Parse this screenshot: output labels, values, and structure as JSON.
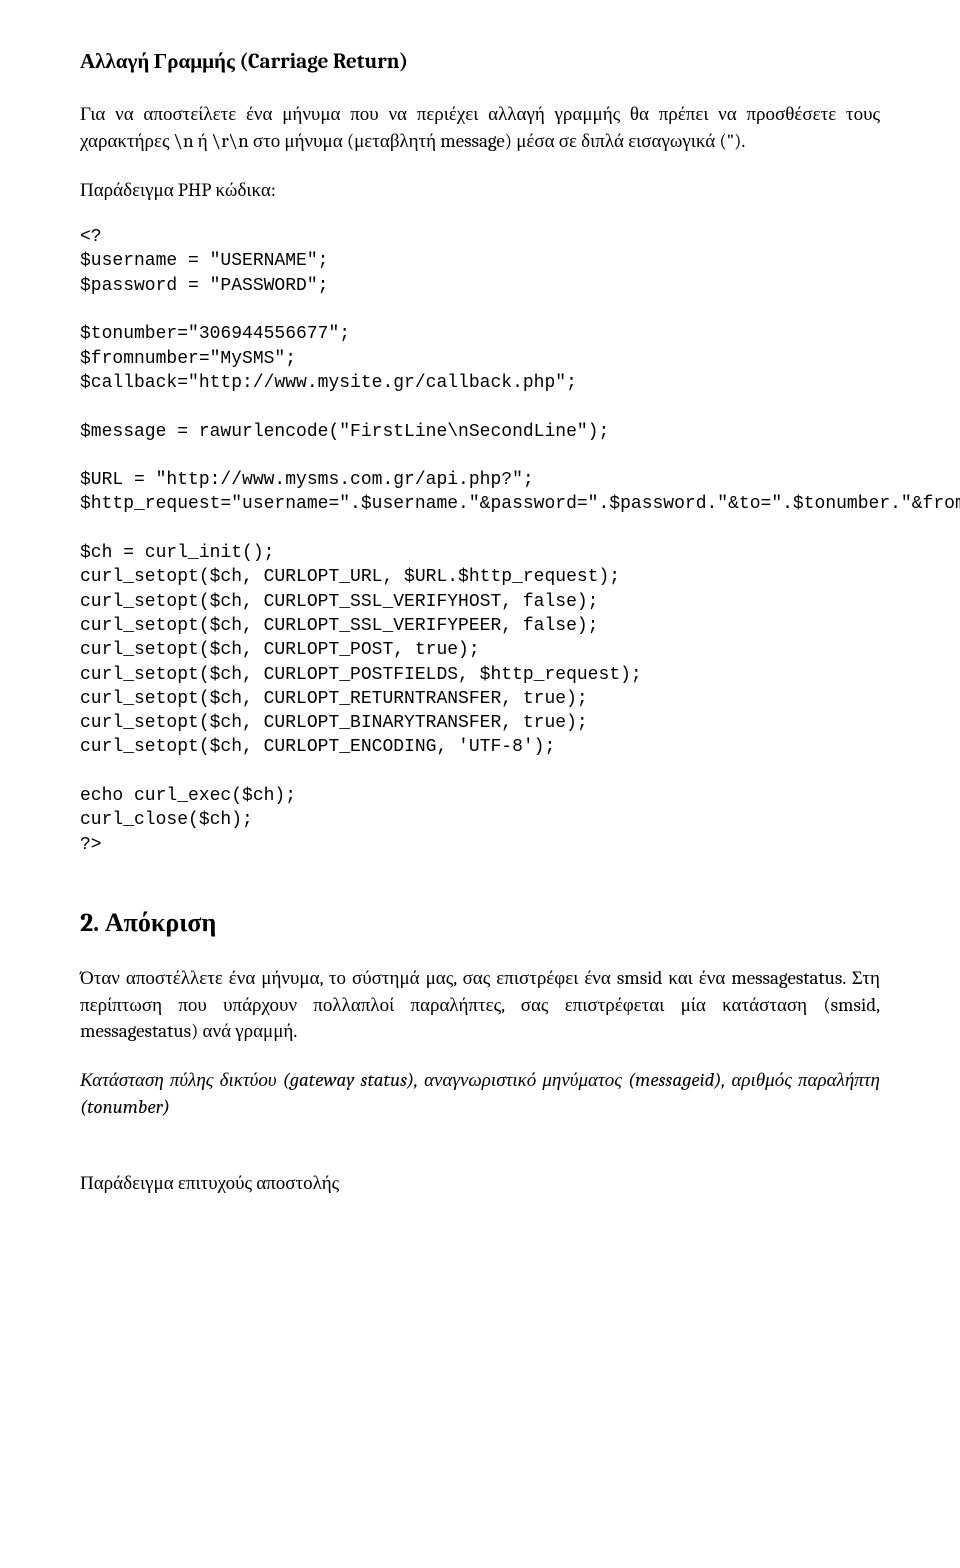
{
  "heading1": "Αλλαγή Γραμμής (Carriage Return)",
  "para1": "Για να αποστείλετε ένα μήνυμα που να περιέχει αλλαγή γραμμής θα πρέπει να προσθέσετε τους χαρακτήρες \\n ή \\r\\n στο μήνυμα (μεταβλητή message) μέσα σε διπλά εισαγωγικά (\").",
  "para2": "Παράδειγμα PHP κώδικα:",
  "code": "<?\n$username = \"USERNAME\";\n$password = \"PASSWORD\";\n\n$tonumber=\"306944556677\";\n$fromnumber=\"MySMS\";\n$callback=\"http://www.mysite.gr/callback.php\";\n\n$message = rawurlencode(\"FirstLine\\nSecondLine\");\n\n$URL = \"http://www.mysms.com.gr/api.php?\";\n$http_request=\"username=\".$username.\"&password=\".$password.\"&to=\".$tonumber.\"&from=\".$fromnumber.\"&message=\".$message.\"&callback=\".$callback;\n\n$ch = curl_init();\ncurl_setopt($ch, CURLOPT_URL, $URL.$http_request);\ncurl_setopt($ch, CURLOPT_SSL_VERIFYHOST, false);\ncurl_setopt($ch, CURLOPT_SSL_VERIFYPEER, false);\ncurl_setopt($ch, CURLOPT_POST, true);\ncurl_setopt($ch, CURLOPT_POSTFIELDS, $http_request);\ncurl_setopt($ch, CURLOPT_RETURNTRANSFER, true);\ncurl_setopt($ch, CURLOPT_BINARYTRANSFER, true);\ncurl_setopt($ch, CURLOPT_ENCODING, 'UTF-8');\n\necho curl_exec($ch);\ncurl_close($ch);\n?>",
  "heading2": "2. Απόκριση",
  "para3": "Όταν αποστέλλετε ένα μήνυμα, το σύστημά μας, σας επιστρέφει ένα smsid και ένα messagestatus. Στη περίπτωση που υπάρχουν πολλαπλοί παραλήπτες, σας επιστρέφεται μία κατάσταση (smsid, messagestatus) ανά γραμμή.",
  "para4": "Κατάσταση πύλης δικτύου (gateway status), αναγνωριστικό μηνύματος (messageid), αριθμός παραλήπτη (tonumber)",
  "para5": "Παράδειγμα επιτυχούς αποστολής"
}
